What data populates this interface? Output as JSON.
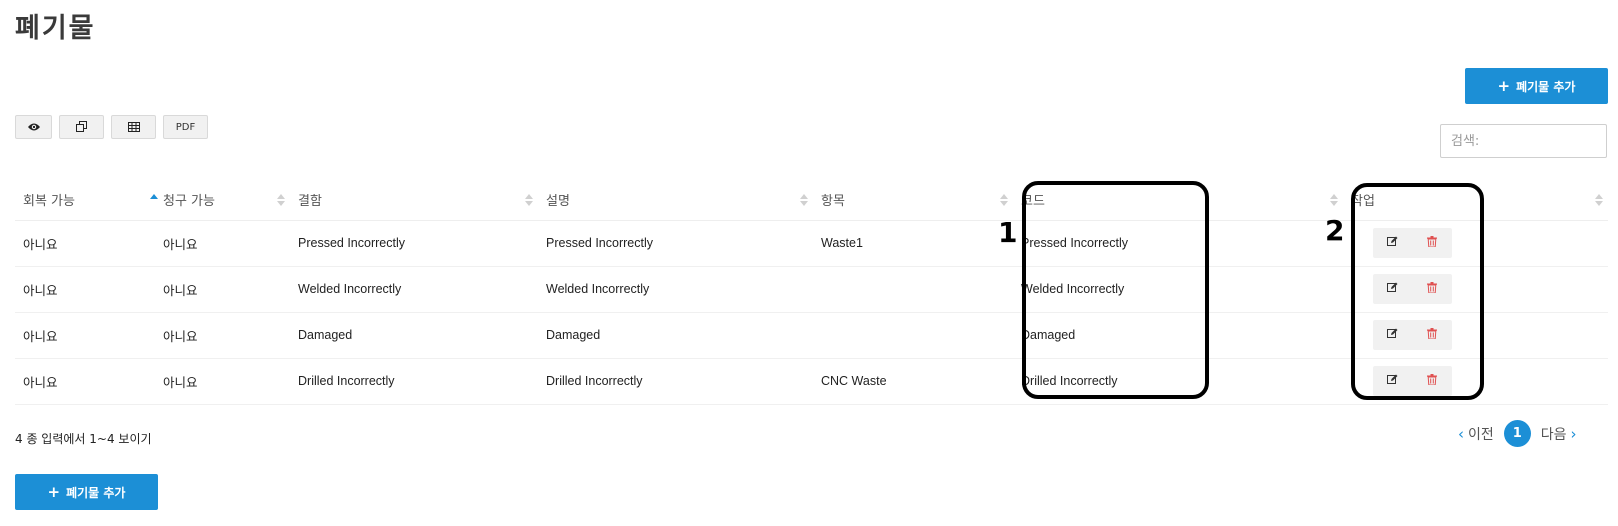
{
  "page": {
    "title": "폐기물"
  },
  "actions": {
    "add_label": "폐기물 추가",
    "plus_icon": "+"
  },
  "toolbar": {
    "buttons": [
      {
        "icon": "eye-icon"
      },
      {
        "icon": "copy-icon"
      },
      {
        "icon": "table-icon"
      },
      {
        "label": "PDF"
      }
    ]
  },
  "search": {
    "placeholder": "검색:"
  },
  "table": {
    "columns": [
      "회복 가능",
      "청구 가능",
      "결함",
      "설명",
      "항목",
      "코드",
      "작업"
    ],
    "sorted_column": "회복 가능",
    "rows": [
      {
        "recoverable": "아니요",
        "billable": "아니요",
        "defect": "Pressed Incorrectly",
        "description": "Pressed Incorrectly",
        "item": "Waste1",
        "code": "Pressed Incorrectly"
      },
      {
        "recoverable": "아니요",
        "billable": "아니요",
        "defect": "Welded Incorrectly",
        "description": "Welded Incorrectly",
        "item": "",
        "code": "Welded Incorrectly"
      },
      {
        "recoverable": "아니요",
        "billable": "아니요",
        "defect": "Damaged",
        "description": "Damaged",
        "item": "",
        "code": "Damaged"
      },
      {
        "recoverable": "아니요",
        "billable": "아니요",
        "defect": "Drilled Incorrectly",
        "description": "Drilled Incorrectly",
        "item": "CNC Waste",
        "code": "Drilled Incorrectly"
      }
    ]
  },
  "annotations": {
    "one": "1",
    "two": "2"
  },
  "footer": {
    "info": "4 종 입력에서 1~4 보이기"
  },
  "pagination": {
    "prev": "이전",
    "current": "1",
    "next": "다음"
  },
  "colors": {
    "accent": "#1c8fd6",
    "delete": "#e05050"
  }
}
